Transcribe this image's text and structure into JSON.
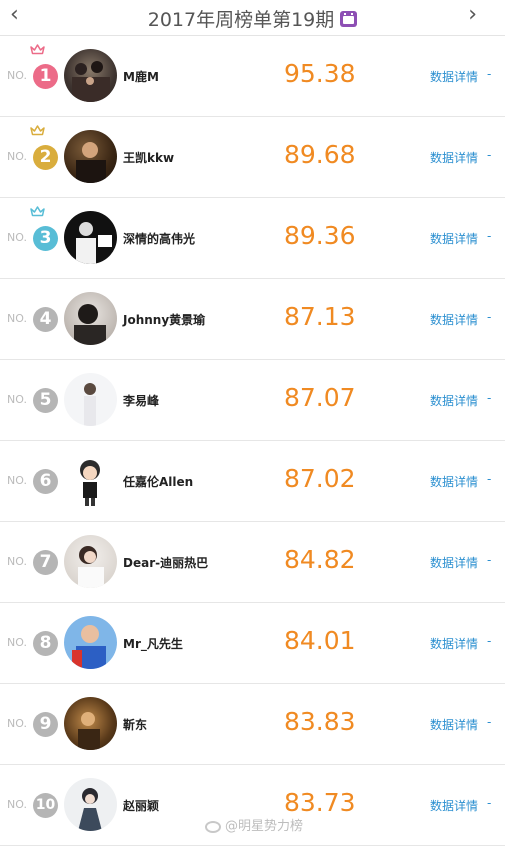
{
  "header": {
    "prev_icon": "‹",
    "title": "2017年周榜单第19期",
    "next_icon": "›",
    "calendar_icon": "calendar-icon"
  },
  "rows": [
    {
      "no": "NO.",
      "rank": "1",
      "name": "M鹿M",
      "score": "95.38",
      "detail": "数据详情",
      "arrow": "-",
      "rank_color": "#ec6b88",
      "crown": "#ec6b88"
    },
    {
      "no": "NO.",
      "rank": "2",
      "name": "王凯kkw",
      "score": "89.68",
      "detail": "数据详情",
      "arrow": "-",
      "rank_color": "#d9ad3d",
      "crown": "#d9ad3d"
    },
    {
      "no": "NO.",
      "rank": "3",
      "name": "深情的高伟光",
      "score": "89.36",
      "detail": "数据详情",
      "arrow": "-",
      "rank_color": "#58bdd6",
      "crown": "#58bdd6"
    },
    {
      "no": "NO.",
      "rank": "4",
      "name": "Johnny黄景瑜",
      "score": "87.13",
      "detail": "数据详情",
      "arrow": "-",
      "rank_color": "#b5b5b5"
    },
    {
      "no": "NO.",
      "rank": "5",
      "name": "李易峰",
      "score": "87.07",
      "detail": "数据详情",
      "arrow": "-",
      "rank_color": "#b5b5b5"
    },
    {
      "no": "NO.",
      "rank": "6",
      "name": "任嘉伦Allen",
      "score": "87.02",
      "detail": "数据详情",
      "arrow": "-",
      "rank_color": "#b5b5b5"
    },
    {
      "no": "NO.",
      "rank": "7",
      "name": "Dear-迪丽热巴",
      "score": "84.82",
      "detail": "数据详情",
      "arrow": "-",
      "rank_color": "#b5b5b5"
    },
    {
      "no": "NO.",
      "rank": "8",
      "name": "Mr_凡先生",
      "score": "84.01",
      "detail": "数据详情",
      "arrow": "-",
      "rank_color": "#b5b5b5"
    },
    {
      "no": "NO.",
      "rank": "9",
      "name": "靳东",
      "score": "83.83",
      "detail": "数据详情",
      "arrow": "-",
      "rank_color": "#b5b5b5"
    },
    {
      "no": "NO.",
      "rank": "10",
      "name": "赵丽颖",
      "score": "83.73",
      "detail": "数据详情",
      "arrow": "-",
      "rank_color": "#b5b5b5"
    }
  ],
  "watermark": "@明星势力榜"
}
